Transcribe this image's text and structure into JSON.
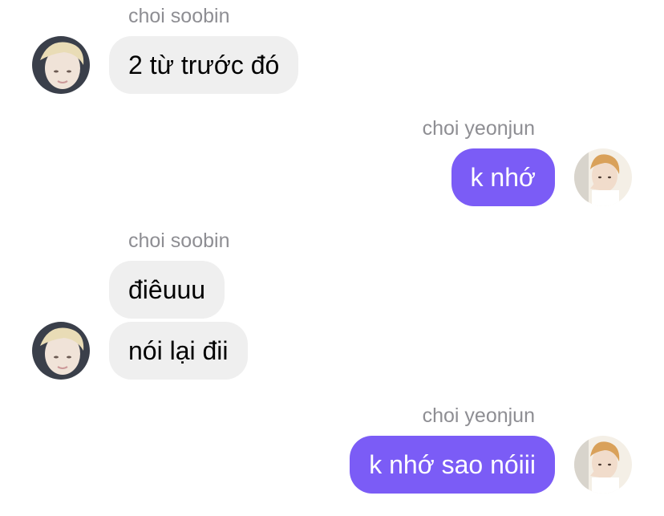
{
  "chat": {
    "messages": [
      {
        "sender": "choi soobin",
        "text": "2 từ trước đó",
        "direction": "incoming"
      },
      {
        "sender": "choi yeonjun",
        "text": "k nhớ",
        "direction": "outgoing"
      },
      {
        "sender": "choi soobin",
        "text": "điêuuu",
        "direction": "incoming"
      },
      {
        "sender": "choi soobin",
        "text": "nói lại đii",
        "direction": "incoming"
      },
      {
        "sender": "choi yeonjun",
        "text": "k nhớ sao nóiii",
        "direction": "outgoing"
      }
    ],
    "labels": {
      "group1": "choi soobin",
      "group2": "choi yeonjun",
      "group3": "choi soobin",
      "group4": "choi yeonjun"
    }
  },
  "colors": {
    "incoming_bubble": "#efefef",
    "outgoing_bubble": "#7b5cf6",
    "sender_name": "#8e8e93"
  },
  "icons": {
    "soobin_avatar": "user-avatar-photo",
    "yeonjun_avatar": "user-avatar-photo"
  }
}
